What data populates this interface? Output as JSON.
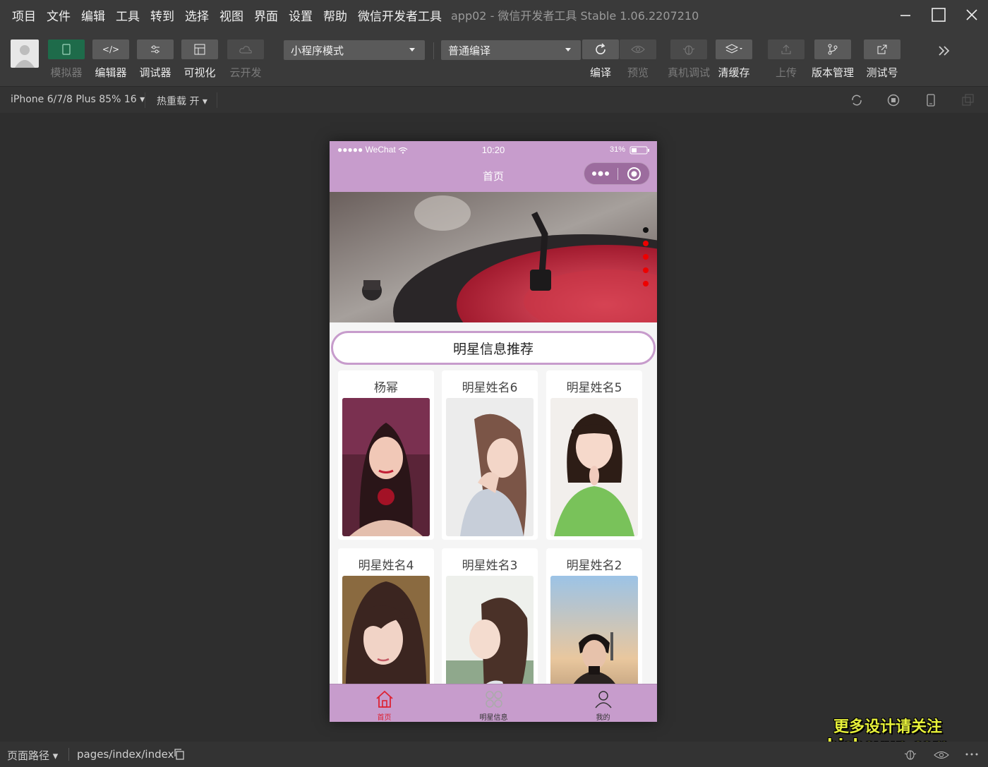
{
  "menu": {
    "items": [
      "项目",
      "文件",
      "编辑",
      "工具",
      "转到",
      "选择",
      "视图",
      "界面",
      "设置",
      "帮助",
      "微信开发者工具"
    ],
    "app_title": "app02 - 微信开发者工具 Stable 1.06.2207210"
  },
  "toolbar": {
    "simulator": "模拟器",
    "editor": "编辑器",
    "debugger": "调试器",
    "visual": "可视化",
    "cloud": "云开发",
    "mode_select": "小程序模式",
    "compile_select": "普通编译",
    "compile": "编译",
    "preview": "预览",
    "real_debug": "真机调试",
    "clear_cache": "清缓存",
    "upload": "上传",
    "version": "版本管理",
    "test_account": "测试号"
  },
  "subbar": {
    "device": "iPhone 6/7/8 Plus 85% 16 ▾",
    "hot_reload": "热重载 开 ▾"
  },
  "phone": {
    "status": {
      "carrier": "●●●●● WeChat",
      "time": "10:20",
      "battery": "31%"
    },
    "nav_title": "首页",
    "section_title": "明星信息推荐",
    "cards": [
      {
        "name": "杨幂"
      },
      {
        "name": "明星姓名6"
      },
      {
        "name": "明星姓名5"
      },
      {
        "name": "明星姓名4"
      },
      {
        "name": "明星姓名3"
      },
      {
        "name": "明星姓名2"
      }
    ],
    "tabs": [
      {
        "label": "首页",
        "icon": "home-icon",
        "active": true
      },
      {
        "label": "明星信息",
        "icon": "grid-icon",
        "active": false
      },
      {
        "label": "我的",
        "icon": "user-icon",
        "active": false
      }
    ]
  },
  "bottombar": {
    "path_label": "页面路径 ▾",
    "path_value": "pages/index/index"
  },
  "watermark": {
    "line1": "更多设计请关注",
    "line2": "bisheyun.com"
  },
  "colors": {
    "accent": "#c79ccc",
    "active_tab": "#dd2233",
    "editor_bg": "#2e2e2e"
  }
}
